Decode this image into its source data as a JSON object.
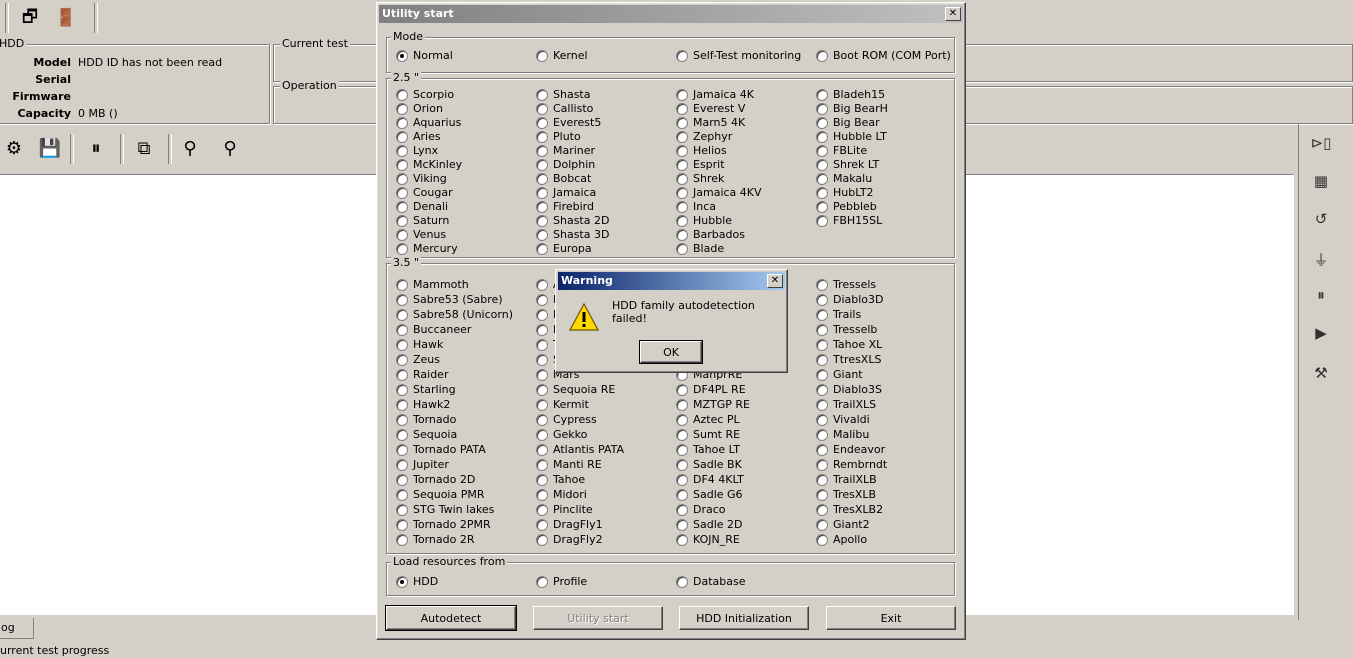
{
  "app": {
    "hdd_group_title": "HDD",
    "info_labels": [
      "Model",
      "Serial",
      "Firmware",
      "Capacity"
    ],
    "info_values": [
      "HDD ID has not been read",
      "",
      "",
      "0 MB ()"
    ],
    "current_test_title": "Current test",
    "operation_title": "Operation",
    "log_tab": "og",
    "status_text": "urrent test progress"
  },
  "dialog": {
    "title": "Utility start",
    "close_glyph": "✕",
    "mode": {
      "title": "Mode",
      "options": [
        "Normal",
        "Kernel",
        "Self-Test monitoring",
        "Boot ROM (COM Port)"
      ],
      "selected": 0
    },
    "g25": {
      "title": "2.5 \"",
      "columns": [
        [
          "Scorpio",
          "Orion",
          "Aquarius",
          "Aries",
          "Lynx",
          "McKinley",
          "Viking",
          "Cougar",
          "Denali",
          "Saturn",
          "Venus",
          "Mercury"
        ],
        [
          "Shasta",
          "Callisto",
          "Everest5",
          "Pluto",
          "Mariner",
          "Dolphin",
          "Bobcat",
          "Jamaica",
          "Firebird",
          "Shasta 2D",
          "Shasta 3D",
          "Europa"
        ],
        [
          "Jamaica 4K",
          "Everest V",
          "Marn5 4K",
          "Zephyr",
          "Helios",
          "Esprit",
          "Shrek",
          "Jamaica 4KV",
          "Inca",
          "Hubble",
          "Barbados",
          "Blade"
        ],
        [
          "Bladeh15",
          "Big BearH",
          "Big Bear",
          "Hubble LT",
          "FBLite",
          "Shrek LT",
          "Makalu",
          "HubLT2",
          "Pebbleb",
          "FBH15SL"
        ]
      ]
    },
    "g35": {
      "title": "3.5 \"",
      "columns": [
        [
          "Mammoth",
          "Sabre53 (Sabre)",
          "Sabre58 (Unicorn)",
          "Buccaneer",
          "Hawk",
          "Zeus",
          "Raider",
          "Starling",
          "Hawk2",
          "Tornado",
          "Sequoia",
          "Tornado PATA",
          "Jupiter",
          "Tornado 2D",
          "Sequoia PMR",
          "STG Twin lakes",
          "Tornado 2PMR",
          "Tornado 2R"
        ],
        [
          "A",
          "F",
          "H",
          "H",
          "T",
          "S",
          "Mars",
          "Sequoia RE",
          "Kermit",
          "Cypress",
          "Gekko",
          "Atlantis PATA",
          "Manti RE",
          "Tahoe",
          "Midori",
          "Pinclite",
          "DragFly1",
          "DragFly2"
        ],
        [
          "",
          "",
          "",
          "",
          "",
          "",
          "ManprRE",
          "DF4PL RE",
          "MZTGP RE",
          "Aztec PL",
          "Sumt RE",
          "Tahoe LT",
          "Sadle BK",
          "DF4 4KLT",
          "Sadle G6",
          "Draco",
          "Sadle 2D",
          "KOJN_RE"
        ],
        [
          "Tressels",
          "Diablo3D",
          "Trails",
          "Tresselb",
          "Tahoe XL",
          "TtresXLS",
          "Giant",
          "Diablo3S",
          "TrailXLS",
          "Vivaldi",
          "Malibu",
          "Endeavor",
          "Rembrndt",
          "TrailXLB",
          "TresXLB",
          "TresXLB2",
          "Giant2",
          "Apollo"
        ]
      ]
    },
    "load": {
      "title": "Load resources from",
      "options": [
        "HDD",
        "Profile",
        "Database"
      ],
      "selected": 0
    },
    "buttons": {
      "autodetect": "Autodetect",
      "utility_start": "Utility start",
      "hdd_init": "HDD Initialization",
      "exit": "Exit"
    }
  },
  "warning": {
    "title": "Warning",
    "close_glyph": "✕",
    "message": "HDD family autodetection failed!",
    "ok": "OK"
  }
}
